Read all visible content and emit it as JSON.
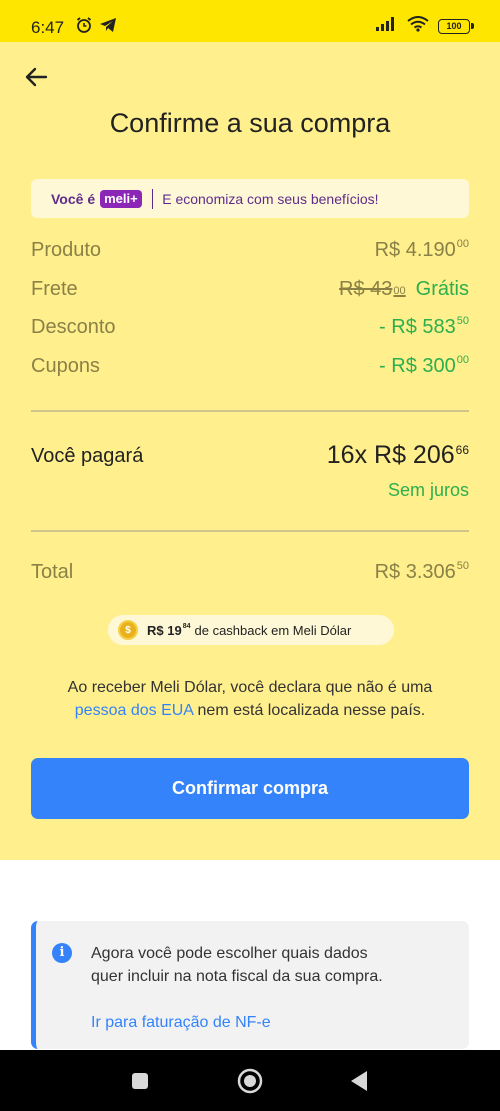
{
  "status_bar": {
    "time": "6:47",
    "battery": "100",
    "icons": [
      "alarm-icon",
      "telegram-icon",
      "signal-icon",
      "wifi-icon",
      "battery-icon"
    ]
  },
  "header": {
    "title": "Confirme a sua compra"
  },
  "meli_banner": {
    "prefix": "Você é",
    "badge": "meli+",
    "message": "E economiza com seus benefícios!"
  },
  "summary": {
    "produto": {
      "label": "Produto",
      "value": "R$ 4.190",
      "cents": "00"
    },
    "frete": {
      "label": "Frete",
      "old_value": "R$ 43",
      "old_cents": "00",
      "value": "Grátis"
    },
    "desconto": {
      "label": "Desconto",
      "value": "- R$ 583",
      "cents": "50"
    },
    "cupons": {
      "label": "Cupons",
      "value": "- R$ 300",
      "cents": "00"
    }
  },
  "payment": {
    "label": "Você pagará",
    "installments": "16x R$ 206",
    "cents": "66",
    "note": "Sem juros"
  },
  "total": {
    "label": "Total",
    "value": "R$ 3.306",
    "cents": "50"
  },
  "cashback": {
    "amount": "R$ 19",
    "cents": "84",
    "text": "de cashback em Meli Dólar"
  },
  "disclaimer": {
    "text_before": "Ao receber Meli Dólar, você declara que não é uma",
    "link": "pessoa dos EUA",
    "text_after": "nem está localizada nesse país."
  },
  "confirm_button": {
    "label": "Confirmar compra"
  },
  "info_card": {
    "text": "Agora você pode escolher quais dados quer incluir na nota fiscal da sua compra.",
    "link": "Ir para faturação de NF-e"
  },
  "colors": {
    "brand_yellow": "#FFE600",
    "panel_yellow": "#FFEF8D",
    "accent_blue": "#3483FA",
    "success_green": "#2DAF4E",
    "meli_purple": "#8B26B7"
  }
}
